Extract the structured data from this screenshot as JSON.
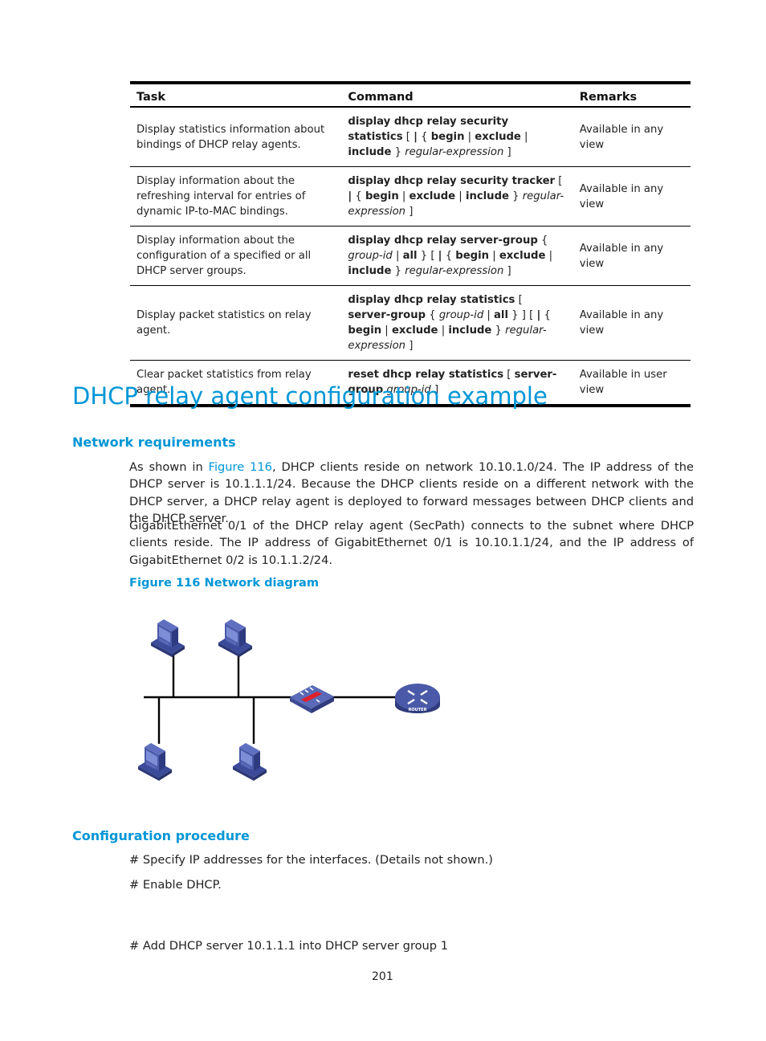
{
  "table": {
    "headers": [
      "Task",
      "Command",
      "Remarks"
    ],
    "rows": [
      {
        "task": "Display statistics information about bindings of DHCP relay agents.",
        "command": [
          {
            "t": "display dhcp relay security statistics",
            "s": "kw"
          },
          {
            "t": " [ ",
            "s": ""
          },
          {
            "t": "|",
            "s": "kw"
          },
          {
            "t": " { ",
            "s": ""
          },
          {
            "t": "begin",
            "s": "kw"
          },
          {
            "t": " | ",
            "s": ""
          },
          {
            "t": "exclude",
            "s": "kw"
          },
          {
            "t": " | ",
            "s": ""
          },
          {
            "t": "include",
            "s": "kw"
          },
          {
            "t": " } ",
            "s": ""
          },
          {
            "t": "regular-expression",
            "s": "arg"
          },
          {
            "t": " ]",
            "s": ""
          }
        ],
        "remarks": "Available in any view"
      },
      {
        "task": "Display information about the refreshing interval for entries of dynamic IP-to-MAC bindings.",
        "command": [
          {
            "t": "display dhcp relay security tracker",
            "s": "kw"
          },
          {
            "t": " [ ",
            "s": ""
          },
          {
            "t": "|",
            "s": "kw"
          },
          {
            "t": " { ",
            "s": ""
          },
          {
            "t": "begin",
            "s": "kw"
          },
          {
            "t": " | ",
            "s": ""
          },
          {
            "t": "exclude",
            "s": "kw"
          },
          {
            "t": " | ",
            "s": ""
          },
          {
            "t": "include",
            "s": "kw"
          },
          {
            "t": " } ",
            "s": ""
          },
          {
            "t": "regular-expression",
            "s": "arg"
          },
          {
            "t": " ]",
            "s": ""
          }
        ],
        "remarks": "Available in any view"
      },
      {
        "task": "Display information about the configuration of a specified or all DHCP server groups.",
        "command": [
          {
            "t": "display dhcp relay server-group",
            "s": "kw"
          },
          {
            "t": " { ",
            "s": ""
          },
          {
            "t": "group-id",
            "s": "arg"
          },
          {
            "t": " | ",
            "s": ""
          },
          {
            "t": "all",
            "s": "kw"
          },
          {
            "t": " } [ ",
            "s": ""
          },
          {
            "t": "|",
            "s": "kw"
          },
          {
            "t": " { ",
            "s": ""
          },
          {
            "t": "begin",
            "s": "kw"
          },
          {
            "t": " | ",
            "s": ""
          },
          {
            "t": "exclude",
            "s": "kw"
          },
          {
            "t": " | ",
            "s": ""
          },
          {
            "t": "include",
            "s": "kw"
          },
          {
            "t": " } ",
            "s": ""
          },
          {
            "t": "regular-expression",
            "s": "arg"
          },
          {
            "t": " ]",
            "s": ""
          }
        ],
        "remarks": "Available in any view"
      },
      {
        "task": "Display packet statistics on relay agent.",
        "command": [
          {
            "t": "display dhcp relay statistics",
            "s": "kw"
          },
          {
            "t": " [ ",
            "s": ""
          },
          {
            "t": "server-group",
            "s": "kw"
          },
          {
            "t": " { ",
            "s": ""
          },
          {
            "t": "group-id",
            "s": "arg"
          },
          {
            "t": " | ",
            "s": ""
          },
          {
            "t": "all",
            "s": "kw"
          },
          {
            "t": " } ] [ ",
            "s": ""
          },
          {
            "t": "|",
            "s": "kw"
          },
          {
            "t": " { ",
            "s": ""
          },
          {
            "t": "begin",
            "s": "kw"
          },
          {
            "t": " | ",
            "s": ""
          },
          {
            "t": "exclude",
            "s": "kw"
          },
          {
            "t": " | ",
            "s": ""
          },
          {
            "t": "include",
            "s": "kw"
          },
          {
            "t": " } ",
            "s": ""
          },
          {
            "t": "regular-expression",
            "s": "arg"
          },
          {
            "t": " ]",
            "s": ""
          }
        ],
        "remarks": "Available in any view"
      },
      {
        "task": "Clear packet statistics from relay agent.",
        "command": [
          {
            "t": "reset dhcp relay statistics",
            "s": "kw"
          },
          {
            "t": " [ ",
            "s": ""
          },
          {
            "t": "server-group",
            "s": "kw"
          },
          {
            "t": " ",
            "s": ""
          },
          {
            "t": "group-id",
            "s": "arg"
          },
          {
            "t": " ]",
            "s": ""
          }
        ],
        "remarks": "Available in user view"
      }
    ]
  },
  "section_title": "DHCP relay agent configuration example",
  "network_requirements": {
    "heading": "Network requirements",
    "para1_prefix": "As shown in ",
    "para1_link": "Figure 116",
    "para1_suffix": ", DHCP clients reside on network 10.10.1.0/24. The IP address of the DHCP server is 10.1.1.1/24. Because the DHCP clients reside on a different network with the DHCP server, a DHCP relay agent is deployed to forward messages between DHCP clients and the DHCP server.",
    "para2": "GigabitEthernet 0/1 of the DHCP relay agent (SecPath) connects to the subnet where DHCP clients reside. The IP address of GigabitEthernet 0/1 is 10.10.1.1/24, and the IP address of GigabitEthernet 0/2 is 10.1.1.2/24.",
    "figure_caption": "Figure 116 Network diagram",
    "router_label": "ROUTER"
  },
  "configuration_procedure": {
    "heading": "Configuration procedure",
    "steps": [
      "# Specify IP addresses for the interfaces. (Details not shown.)",
      "# Enable DHCP.",
      "# Add DHCP server 10.1.1.1 into DHCP server group 1"
    ]
  },
  "page_number": "201",
  "colors": {
    "accent": "#0096d6",
    "device_blue": "#4a5aa8",
    "firewall_red": "#e0202a"
  }
}
